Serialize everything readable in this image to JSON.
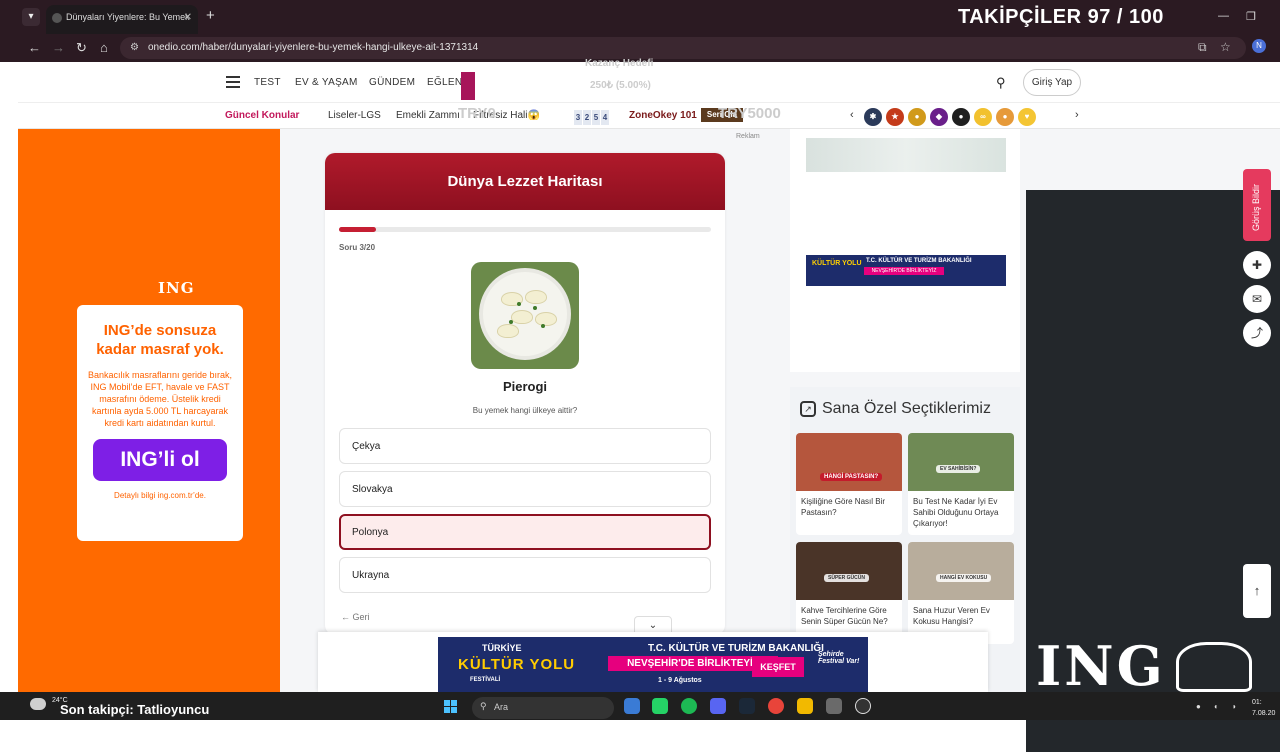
{
  "browser": {
    "tab_title": "Dünyaları Yiyenlere: Bu Yemek",
    "url": "onedio.com/haber/dunyalari-yiyenlere-bu-yemek-hangi-ulkeye-ait-1371314",
    "profile_initial": "N"
  },
  "overlay": {
    "followers_goal": "TAKİPÇİLER 97 / 100",
    "last_follower": "Son takipçi: Tatlioyuncu",
    "ghost_text_1": "Kazanç Hedefi",
    "ghost_text_2": "250₺ (5.00%)",
    "ghost_text_3": "TRY0",
    "ghost_text_4": "TRY5000",
    "ing_watermark": "ING"
  },
  "site": {
    "nav": [
      "TEST",
      "EV & YAŞAM",
      "GÜNDEM",
      "EĞLEN"
    ],
    "login": "Giriş Yap",
    "topics_heading": "Güncel Konular",
    "topics": [
      "Liseler-LGS",
      "Emekli Zammı",
      "Filtresiz Hali😱"
    ],
    "digits": [
      "3",
      "2",
      "5",
      "4"
    ],
    "zone": "ZoneOkey 101",
    "seri": "Seri Ola",
    "ad_label": "Reklam"
  },
  "left_ad": {
    "brand": "ING",
    "headline": "ING’de sonsuza kadar masraf yok.",
    "body": "Bankacılık masraflarını geride bırak, ING Mobil’de EFT, havale ve FAST masrafını ödeme. Üstelik kredi kartınla ayda 5.000 TL harcayarak kredi kartı aidatından kurtul.",
    "cta": "ING’li ol",
    "fine": "Detaylı bilgi ing.com.tr’de."
  },
  "quiz": {
    "title": "Dünya Lezzet Haritası",
    "question_counter": "Soru 3/20",
    "progress": 0.1,
    "food": "Pierogi",
    "question": "Bu yemek hangi ülkeye aittir?",
    "options": [
      "Çekya",
      "Slovakya",
      "Polonya",
      "Ukrayna"
    ],
    "selected_index": 2,
    "back": "← Geri"
  },
  "small_banner": {
    "logo": "KÜLTÜR YOLU",
    "line1": "T.C. KÜLTÜR VE TURİZM BAKANLIĞI",
    "line2": "NEVŞEHİR'DE BİRLİKTEYİZ"
  },
  "picks": {
    "title": "Sana Özel Seçtiklerimiz",
    "items": [
      {
        "caption": "Kişiliğine Göre Nasıl Bir Pastasın?",
        "tag": "HANGİ PASTASIN?",
        "color": "#b5563d"
      },
      {
        "caption": "Bu Test Ne Kadar İyi Ev Sahibi Olduğunu Ortaya Çıkarıyor!",
        "tag": "EV SAHİBİSİN?",
        "color": "#6f8a55"
      },
      {
        "caption": "Kahve Tercihlerine Göre Senin Süper Gücün Ne?",
        "tag": "SÜPER GÜCÜN",
        "color": "#4a3428"
      },
      {
        "caption": "Sana Huzur Veren Ev Kokusu Hangisi?",
        "tag": "HANGİ EV KOKUSU",
        "color": "#b8ad9c"
      }
    ]
  },
  "side": {
    "report": "Görüş Bildir"
  },
  "bottom_ad": {
    "top": "TÜRKİYE",
    "brand": "KÜLTÜR YOLU",
    "festival": "FESTİVALİ",
    "ministry": "T.C. KÜLTÜR VE TURİZM BAKANLIĞI",
    "slogan": "NEVŞEHİR'DE BİRLİKTEYİZ",
    "dates": "1 - 9 Ağustos",
    "cta": "KEŞFET",
    "tagline": "Şehirde Festival Var!"
  },
  "taskbar": {
    "temp": "24°C",
    "search": "Ara",
    "time": "01:",
    "date": "7.08.20"
  },
  "colors": {
    "accent": "#c51f33",
    "ing_orange": "#ff6a00",
    "ing_purple": "#7e1fe6"
  }
}
